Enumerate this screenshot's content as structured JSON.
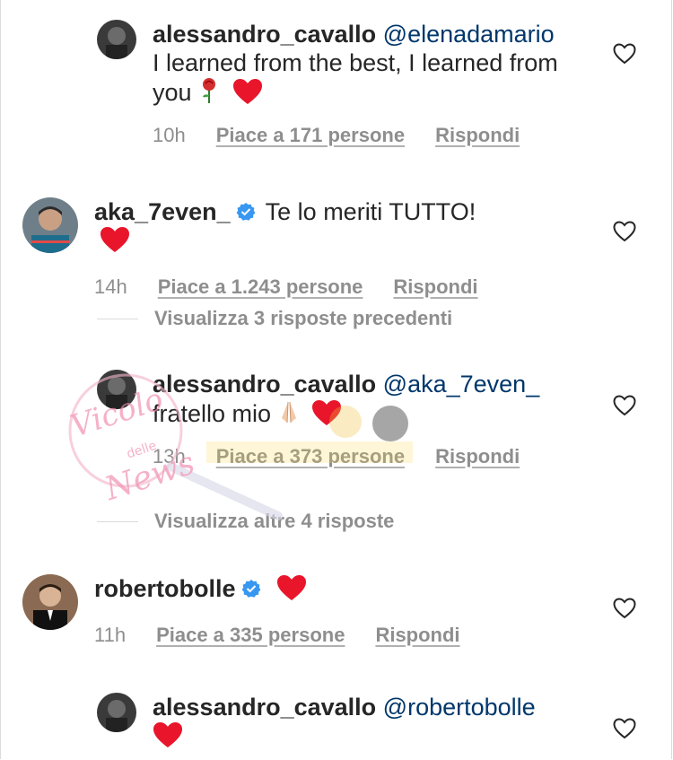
{
  "comments": [
    {
      "username": "alessandro_cavallo",
      "mention": "@elenadamario",
      "text": "I learned from the best, I learned from you",
      "time": "10h",
      "likes": "Piace a 171 persone",
      "reply": "Rispondi"
    },
    {
      "username": "aka_7even_",
      "text": "Te lo meriti TUTTO!",
      "time": "14h",
      "likes": "Piace a 1.243 persone",
      "reply": "Rispondi"
    },
    {
      "username": "alessandro_cavallo",
      "mention": "@aka_7even_",
      "text": "fratello mio",
      "time": "13h",
      "likes": "Piace a 373 persone",
      "reply": "Rispondi"
    },
    {
      "username": "robertobolle",
      "time": "11h",
      "likes": "Piace a 335 persone",
      "reply": "Rispondi"
    },
    {
      "username": "alessandro_cavallo",
      "mention": "@robertobolle"
    }
  ],
  "view_previous": "Visualizza 3 risposte precedenti",
  "view_more": "Visualizza altre 4 risposte",
  "watermark": {
    "line1": "Vicolo",
    "line2": "delle",
    "line3": "News"
  },
  "colors": {
    "heart": "#e8152b",
    "verified": "#3897f0",
    "mention": "#00376b",
    "muted": "#8e8e8e"
  },
  "icons": [
    "heart-outline-icon",
    "verified-badge-icon",
    "red-heart-emoji",
    "rose-emoji",
    "praying-hands-emoji"
  ]
}
